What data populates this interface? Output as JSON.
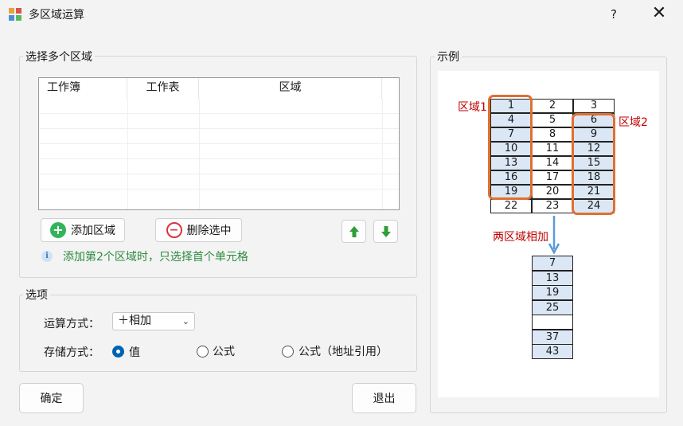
{
  "window": {
    "title": "多区域运算",
    "help": "?",
    "close": "✕"
  },
  "regions_group": {
    "label": "选择多个区域",
    "columns": [
      "工作簿",
      "工作表",
      "区域"
    ],
    "add_button": "添加区域",
    "delete_button": "删除选中",
    "up_icon": "arrow-up-icon",
    "down_icon": "arrow-down-icon",
    "hint": "添加第2个区域时，只选择首个单元格"
  },
  "options_group": {
    "label": "选项",
    "operation_label": "运算方式：",
    "operation_value": "＋相加",
    "storage_label": "存储方式：",
    "storage_options": [
      "值",
      "公式",
      "公式（地址引用）"
    ],
    "storage_selected": "值"
  },
  "footer": {
    "ok": "确定",
    "exit": "退出"
  },
  "example": {
    "label": "示例",
    "grid": [
      [
        "1",
        "2",
        "3"
      ],
      [
        "4",
        "5",
        "6"
      ],
      [
        "7",
        "8",
        "9"
      ],
      [
        "10",
        "11",
        "12"
      ],
      [
        "13",
        "14",
        "15"
      ],
      [
        "16",
        "17",
        "18"
      ],
      [
        "19",
        "20",
        "21"
      ],
      [
        "22",
        "23",
        "24"
      ]
    ],
    "region1_label": "区域1",
    "region2_label": "区域2",
    "sum_label": "两区域相加",
    "result": [
      "7",
      "13",
      "19",
      "25",
      "",
      "37",
      "43"
    ],
    "colors": {
      "highlight": "#dbe7f5",
      "frame": "#e07030",
      "label": "#c00000",
      "arrow": "#5b9bd5"
    }
  }
}
